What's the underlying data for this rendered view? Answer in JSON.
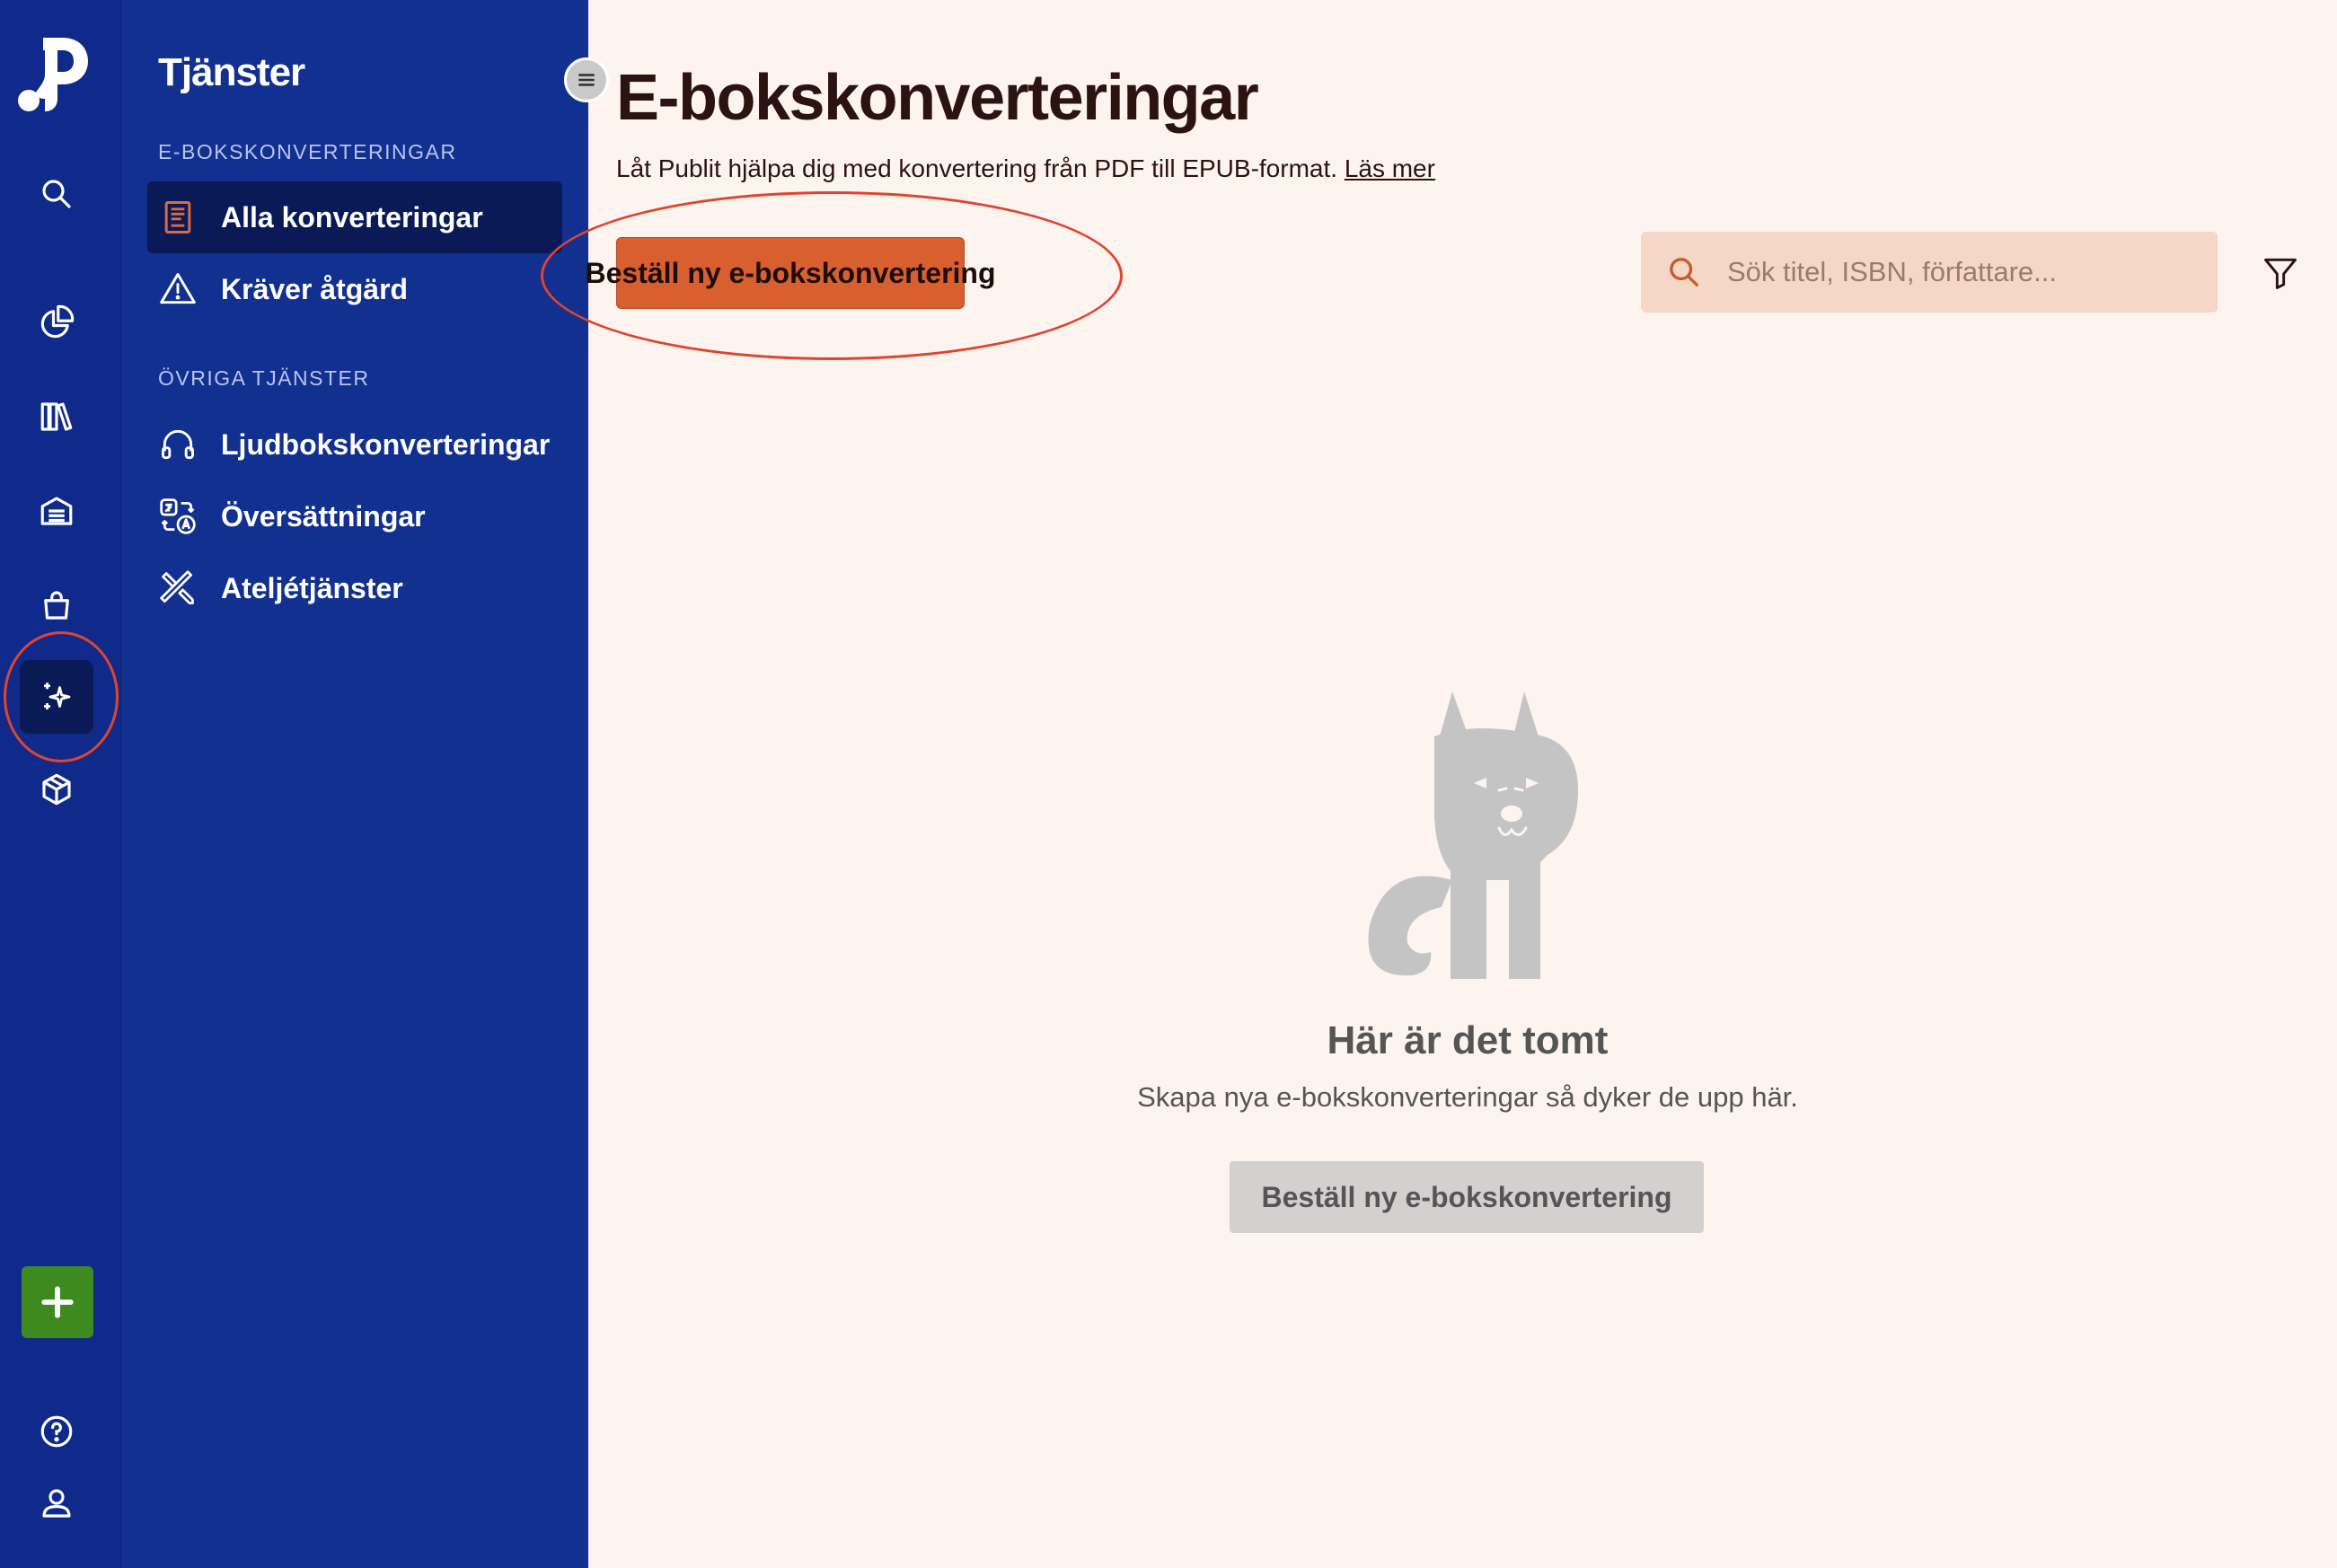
{
  "submenu": {
    "title": "Tjänster",
    "section_ebook": "E-BOKSKONVERTERINGAR",
    "section_other": "ÖVRIGA TJÄNSTER",
    "items": [
      {
        "label": "Alla konverteringar"
      },
      {
        "label": "Kräver åtgärd"
      },
      {
        "label": "Ljudbokskonverteringar"
      },
      {
        "label": "Översättningar"
      },
      {
        "label": "Ateljétjänster"
      }
    ]
  },
  "main": {
    "title": "E-bokskonverteringar",
    "description": "Låt Publit hjälpa dig med konvertering från PDF till EPUB-format.",
    "read_more": "Läs mer",
    "order_button": "Beställ ny e-bokskonvertering",
    "search_placeholder": "Sök titel, ISBN, författare...",
    "empty": {
      "title": "Här är det tomt",
      "description": "Skapa nya e-bokskonverteringar så dyker de upp här.",
      "button": "Beställ ny e-bokskonvertering"
    }
  },
  "colors": {
    "rail_bg": "#0f2a8a",
    "submenu_bg": "#12308f",
    "active_bg": "#0a1a56",
    "accent": "#d95f2f",
    "page_bg": "#fdf4f0",
    "search_bg": "#f6d6c6",
    "add_button": "#3d8a1e"
  },
  "icons": {
    "rail": [
      "logo-icon",
      "search-icon",
      "pie-chart-icon",
      "library-icon",
      "warehouse-icon",
      "shopping-bag-icon",
      "sparkles-icon",
      "package-icon",
      "plus-icon",
      "help-icon",
      "user-icon"
    ],
    "submenu": [
      "document-icon",
      "warning-icon",
      "headphones-icon",
      "translate-icon",
      "tools-icon"
    ]
  }
}
